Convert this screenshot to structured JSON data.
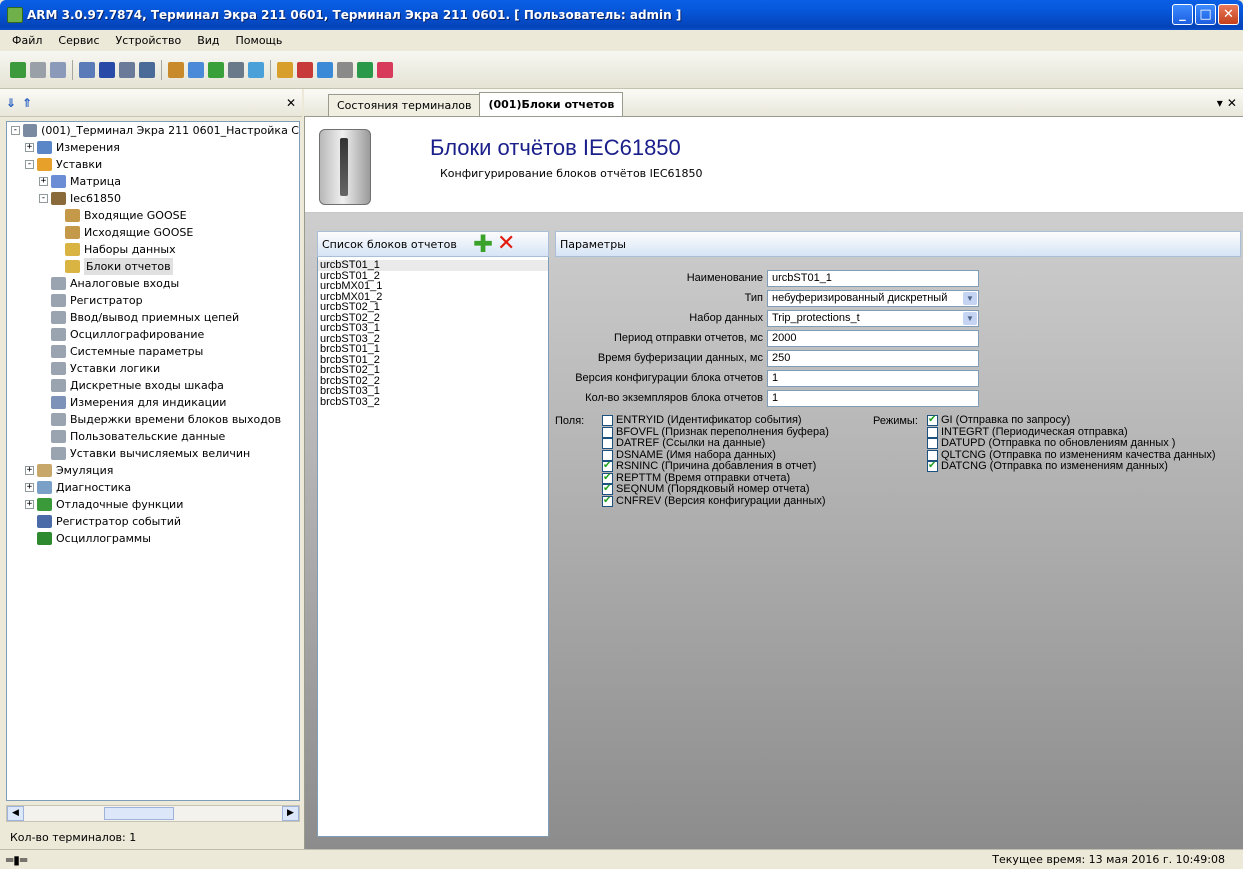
{
  "window": {
    "title": "ARM 3.0.97.7874, Терминал Экра 211 0601, Терминал Экра 211 0601. [ Пользователь: admin ]"
  },
  "menu": [
    "Файл",
    "Сервис",
    "Устройство",
    "Вид",
    "Помощь"
  ],
  "tree": {
    "items": [
      {
        "label": "(001)_Терминал Экра 211 0601_Настройка С",
        "indent": 0,
        "exp": "−",
        "icon": "terminal-icon",
        "color": "#7a8aa0"
      },
      {
        "label": "Измерения",
        "indent": 1,
        "exp": "+",
        "icon": "measurements-icon",
        "color": "#5a86c8"
      },
      {
        "label": "Уставки",
        "indent": 1,
        "exp": "−",
        "icon": "settings-folder-icon",
        "color": "#e7a12b"
      },
      {
        "label": "Матрица",
        "indent": 2,
        "exp": "+",
        "icon": "matrix-icon",
        "color": "#6b8dd6"
      },
      {
        "label": "Iec61850",
        "indent": 2,
        "exp": "−",
        "icon": "iec61850-icon",
        "color": "#8a6a3a"
      },
      {
        "label": "Входящие GOOSE",
        "indent": 3,
        "exp": "",
        "icon": "goose-in-icon",
        "color": "#c49a4a"
      },
      {
        "label": "Исходящие GOOSE",
        "indent": 3,
        "exp": "",
        "icon": "goose-out-icon",
        "color": "#c49a4a"
      },
      {
        "label": "Наборы данных",
        "indent": 3,
        "exp": "",
        "icon": "datasets-icon",
        "color": "#d9b443"
      },
      {
        "label": "Блоки отчетов",
        "indent": 3,
        "exp": "",
        "icon": "report-blocks-icon",
        "color": "#d9b443",
        "selected": true
      },
      {
        "label": "Аналоговые входы",
        "indent": 2,
        "exp": "",
        "icon": "table-icon",
        "color": "#9aa4b0"
      },
      {
        "label": "Регистратор",
        "indent": 2,
        "exp": "",
        "icon": "table-icon",
        "color": "#9aa4b0"
      },
      {
        "label": "Ввод/вывод приемных цепей",
        "indent": 2,
        "exp": "",
        "icon": "table-icon",
        "color": "#9aa4b0"
      },
      {
        "label": "Осциллографирование",
        "indent": 2,
        "exp": "",
        "icon": "table-icon",
        "color": "#9aa4b0"
      },
      {
        "label": "Системные параметры",
        "indent": 2,
        "exp": "",
        "icon": "table-icon",
        "color": "#9aa4b0"
      },
      {
        "label": "Уставки логики",
        "indent": 2,
        "exp": "",
        "icon": "table-icon",
        "color": "#9aa4b0"
      },
      {
        "label": "Дискретные входы шкафа",
        "indent": 2,
        "exp": "",
        "icon": "table-icon",
        "color": "#9aa4b0"
      },
      {
        "label": "Измерения для индикации",
        "indent": 2,
        "exp": "",
        "icon": "indication-icon",
        "color": "#7d92b8"
      },
      {
        "label": "Выдержки времени блоков выходов",
        "indent": 2,
        "exp": "",
        "icon": "table-icon",
        "color": "#9aa4b0"
      },
      {
        "label": "Пользовательские данные",
        "indent": 2,
        "exp": "",
        "icon": "table-icon",
        "color": "#9aa4b0"
      },
      {
        "label": "Уставки вычисляемых величин",
        "indent": 2,
        "exp": "",
        "icon": "table-icon",
        "color": "#9aa4b0"
      },
      {
        "label": "Эмуляция",
        "indent": 1,
        "exp": "+",
        "icon": "emulation-icon",
        "color": "#c8a86a"
      },
      {
        "label": "Диагностика",
        "indent": 1,
        "exp": "+",
        "icon": "diagnostics-icon",
        "color": "#7aa0c8"
      },
      {
        "label": "Отладочные функции",
        "indent": 1,
        "exp": "+",
        "icon": "debug-icon",
        "color": "#3a9a3a"
      },
      {
        "label": "Регистратор событий",
        "indent": 1,
        "exp": "",
        "icon": "event-recorder-icon",
        "color": "#4a6aa8"
      },
      {
        "label": "Осциллограммы",
        "indent": 1,
        "exp": "",
        "icon": "oscillograms-icon",
        "color": "#2e8a2e"
      }
    ]
  },
  "left_status": "Кол-во терминалов: 1",
  "tabs": [
    {
      "label": "Состояния терминалов",
      "active": false
    },
    {
      "label": "(001)Блоки отчетов",
      "active": true
    }
  ],
  "banner": {
    "title": "Блоки отчётов IEC61850",
    "subtitle": "Конфигурирование блоков отчётов IEC61850"
  },
  "list": {
    "header": "Список блоков отчетов",
    "items": [
      "urcbST01_1",
      "urcbST01_2",
      "urcbMX01_1",
      "urcbMX01_2",
      "urcbST02_1",
      "urcbST02_2",
      "urcbST03_1",
      "urcbST03_2",
      "brcbST01_1",
      "brcbST01_2",
      "brcbST02_1",
      "brcbST02_2",
      "brcbST03_1",
      "brcbST03_2"
    ],
    "selected": 0
  },
  "params": {
    "header": "Параметры",
    "fields": [
      {
        "label": "Наименование",
        "value": "urcbST01_1",
        "dropdown": false
      },
      {
        "label": "Тип",
        "value": "небуферизированный дискретный",
        "dropdown": true
      },
      {
        "label": "Набор данных",
        "value": "Trip_protections_t",
        "dropdown": true
      },
      {
        "label": "Период отправки отчетов, мс",
        "value": "2000",
        "dropdown": false
      },
      {
        "label": "Время буферизации данных, мс",
        "value": "250",
        "dropdown": false
      },
      {
        "label": "Версия конфигурации блока отчетов",
        "value": "1",
        "dropdown": false
      },
      {
        "label": "Кол-во экземпляров блока отчетов",
        "value": "1",
        "dropdown": false
      }
    ],
    "fields_label": "Поля:",
    "flags": [
      {
        "label": "ENTRYID (Идентификатор события)",
        "checked": false
      },
      {
        "label": "BFOVFL (Признак переполнения буфера)",
        "checked": false
      },
      {
        "label": "DATREF (Ссылки на данные)",
        "checked": false
      },
      {
        "label": "DSNAME (Имя набора данных)",
        "checked": false
      },
      {
        "label": "RSNINC (Причина добавления в отчет)",
        "checked": true
      },
      {
        "label": "REPTTM (Время отправки отчета)",
        "checked": true
      },
      {
        "label": "SEQNUM (Порядковый номер отчета)",
        "checked": true
      },
      {
        "label": "CNFREV (Версия конфигурации данных)",
        "checked": true
      }
    ],
    "modes_label": "Режимы:",
    "modes": [
      {
        "label": "GI (Отправка по запросу)",
        "checked": true
      },
      {
        "label": "INTEGRT (Периодическая отправка)",
        "checked": false
      },
      {
        "label": "DATUPD (Отправка по обновлениям данных )",
        "checked": false
      },
      {
        "label": "QLTCNG (Отправка по изменениям качества данных)",
        "checked": false
      },
      {
        "label": "DATCNG (Отправка по изменениям данных)",
        "checked": true
      }
    ]
  },
  "statusbar": {
    "time": "Текущее время: 13 мая 2016 г. 10:49:08"
  },
  "toolbar_icons": [
    {
      "name": "connect-icon",
      "color": "#3c9a3c"
    },
    {
      "name": "disconnect-icon",
      "color": "#9aa0a8"
    },
    {
      "name": "terminal-props-icon",
      "color": "#8a9ab8"
    },
    {
      "name": "sep",
      "color": ""
    },
    {
      "name": "list-view-icon",
      "color": "#5a7ab8"
    },
    {
      "name": "grid-view-icon",
      "color": "#2a4aa8"
    },
    {
      "name": "tree-view-icon",
      "color": "#6a7a98"
    },
    {
      "name": "layout-dropdown-icon",
      "color": "#4a6a98"
    },
    {
      "name": "sep",
      "color": ""
    },
    {
      "name": "read-icon",
      "color": "#c88a2a"
    },
    {
      "name": "write-icon",
      "color": "#4a8ad8"
    },
    {
      "name": "compare-icon",
      "color": "#3aa03a"
    },
    {
      "name": "filter-icon",
      "color": "#6a7a8a"
    },
    {
      "name": "time-icon",
      "color": "#4aa0d8"
    },
    {
      "name": "sep",
      "color": ""
    },
    {
      "name": "report-icon",
      "color": "#d8a02a"
    },
    {
      "name": "edit-icon",
      "color": "#c83a3a"
    },
    {
      "name": "export-icon",
      "color": "#3a8ad8"
    },
    {
      "name": "import-icon",
      "color": "#8a8a8a"
    },
    {
      "name": "sync-icon",
      "color": "#2a9a4a"
    },
    {
      "name": "book-icon",
      "color": "#d83a5a"
    }
  ]
}
